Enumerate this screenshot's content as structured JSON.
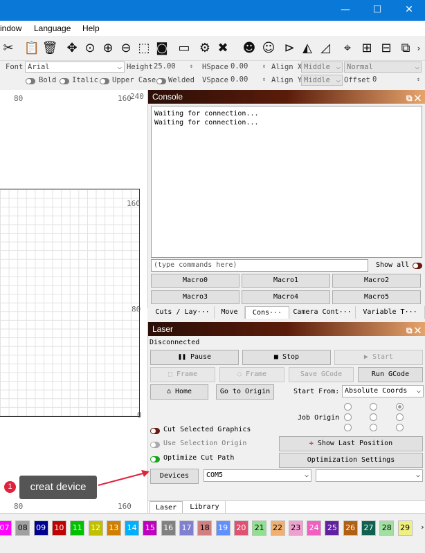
{
  "window": {
    "minimize": "—",
    "maximize": "☐",
    "close": "✕"
  },
  "menu": {
    "window": "indow",
    "language": "Language",
    "help": "Help"
  },
  "toolbar_icons": [
    "scissors-icon",
    "paste-icon",
    "trash-icon",
    "move-icon",
    "zoom-fit-icon",
    "zoom-in-icon",
    "zoom-out-icon",
    "select-frame-icon",
    "camera-icon",
    "monitor-icon",
    "settings-icon",
    "tools-icon",
    "users-icon",
    "user-icon",
    "mirror-icon",
    "flip-icon",
    "triangle-icon",
    "target-icon",
    "align-icon",
    "distribute-icon"
  ],
  "text": {
    "font_label": "Font",
    "font_value": "Arial",
    "height_label": "Height",
    "height_value": "25.00",
    "hspace_label": "HSpace",
    "hspace_value": "0.00",
    "alignx_label": "Align X",
    "alignx_value": "Middle",
    "style_value": "Normal",
    "bold": "Bold",
    "italic": "Italic",
    "upper": "Upper Case",
    "welded": "Welded",
    "vspace_label": "VSpace",
    "vspace_value": "0.00",
    "aligny_label": "Align Y",
    "aligny_value": "Middle",
    "offset_label": "Offset",
    "offset_value": "0"
  },
  "ruler": {
    "top_80": "80",
    "top_160": "160",
    "top_240": "240",
    "left_160": "160",
    "left_80": "80",
    "left_0": "0",
    "bottom_80": "80",
    "bottom_160": "160"
  },
  "console": {
    "title": "Console",
    "log": "Waiting for connection...\nWaiting for connection...",
    "cmd_placeholder": "(type commands here)",
    "show_all": "Show all",
    "macros": [
      "Macro0",
      "Macro1",
      "Macro2",
      "Macro3",
      "Macro4",
      "Macro5"
    ],
    "tabs": [
      "Cuts / Lay···",
      "Move",
      "Cons···",
      "Camera Cont···",
      "Variable T···"
    ]
  },
  "laser": {
    "title": "Laser",
    "status": "Disconnected",
    "pause": "Pause",
    "stop": "Stop",
    "start": "Start",
    "frame1": "Frame",
    "frame2": "Frame",
    "save_gcode": "Save GCode",
    "run_gcode": "Run GCode",
    "home": "Home",
    "go_origin": "Go to Origin",
    "start_from_label": "Start From:",
    "start_from_value": "Absolute Coords",
    "job_origin": "Job Origin",
    "cut_selected": "Cut Selected Graphics",
    "use_selection": "Use Selection Origin",
    "optimize": "Optimize Cut Path",
    "show_last": "Show Last Position",
    "opt_settings": "Optimization Settings",
    "devices": "Devices",
    "port": "COM5",
    "bottom_tabs": [
      "Laser",
      "Library"
    ]
  },
  "palette": [
    {
      "n": "07",
      "c": "#ff00ff"
    },
    {
      "n": "08",
      "c": "#a0a0a0"
    },
    {
      "n": "09",
      "c": "#000090"
    },
    {
      "n": "10",
      "c": "#c00000"
    },
    {
      "n": "11",
      "c": "#00c000"
    },
    {
      "n": "12",
      "c": "#c0c000"
    },
    {
      "n": "13",
      "c": "#d08000"
    },
    {
      "n": "14",
      "c": "#00b0ff"
    },
    {
      "n": "15",
      "c": "#c000c0"
    },
    {
      "n": "16",
      "c": "#808080"
    },
    {
      "n": "17",
      "c": "#8080d0"
    },
    {
      "n": "18",
      "c": "#d08080"
    },
    {
      "n": "19",
      "c": "#6090ff"
    },
    {
      "n": "20",
      "c": "#e05070"
    },
    {
      "n": "21",
      "c": "#90e090"
    },
    {
      "n": "22",
      "c": "#f0b070"
    },
    {
      "n": "23",
      "c": "#f0a0d0"
    },
    {
      "n": "24",
      "c": "#f060c0"
    },
    {
      "n": "25",
      "c": "#6020a0"
    },
    {
      "n": "26",
      "c": "#b06010"
    },
    {
      "n": "27",
      "c": "#106050"
    },
    {
      "n": "28",
      "c": "#a0e0a0"
    },
    {
      "n": "29",
      "c": "#f0f080"
    }
  ],
  "annotation": {
    "number": "1",
    "text": "creat device"
  }
}
